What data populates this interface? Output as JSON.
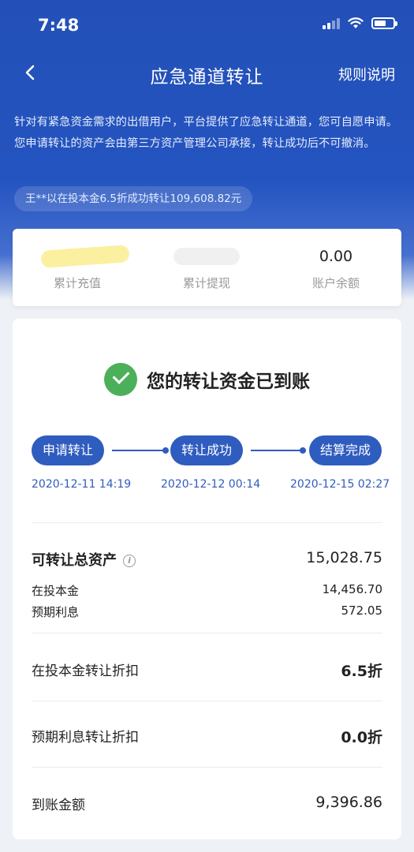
{
  "status_bar": {
    "time": "7:48"
  },
  "nav": {
    "title": "应急通道转让",
    "rules_label": "规则说明"
  },
  "notice": "针对有紧急资金需求的出借用户，平台提供了应急转让通道，您可自愿申请。您申请转让的资产会由第三方资产管理公司承接，转让成功后不可撤消。",
  "ticker": "王**以在投本金6.5折成功转让109,608.82元",
  "summary": {
    "total_recharge_label": "累计充值",
    "total_withdraw_label": "累计提现",
    "balance_value": "0.00",
    "balance_label": "账户余额"
  },
  "status": {
    "message": "您的转让资金已到账"
  },
  "steps": [
    {
      "label": "申请转让",
      "date": "2020-12-11 14:19"
    },
    {
      "label": "转让成功",
      "date": "2020-12-12 00:14"
    },
    {
      "label": "结算完成",
      "date": "2020-12-15 02:27"
    }
  ],
  "details": {
    "total_assets_label": "可转让总资产",
    "total_assets_value": "15,028.75",
    "principal_label": "在投本金",
    "principal_value": "14,456.70",
    "interest_label": "预期利息",
    "interest_value": "572.05",
    "principal_discount_label": "在投本金转让折扣",
    "principal_discount_value": "6.5折",
    "interest_discount_label": "预期利息转让折扣",
    "interest_discount_value": "0.0折",
    "received_label": "到账金额",
    "received_value": "9,396.86"
  },
  "colors": {
    "primary": "#2350b8",
    "accent": "#2f5cbf",
    "success": "#4cb05a"
  },
  "icons": [
    "signal-icon",
    "wifi-icon",
    "battery-icon",
    "back-chevron-icon",
    "check-circle-icon",
    "info-icon"
  ]
}
